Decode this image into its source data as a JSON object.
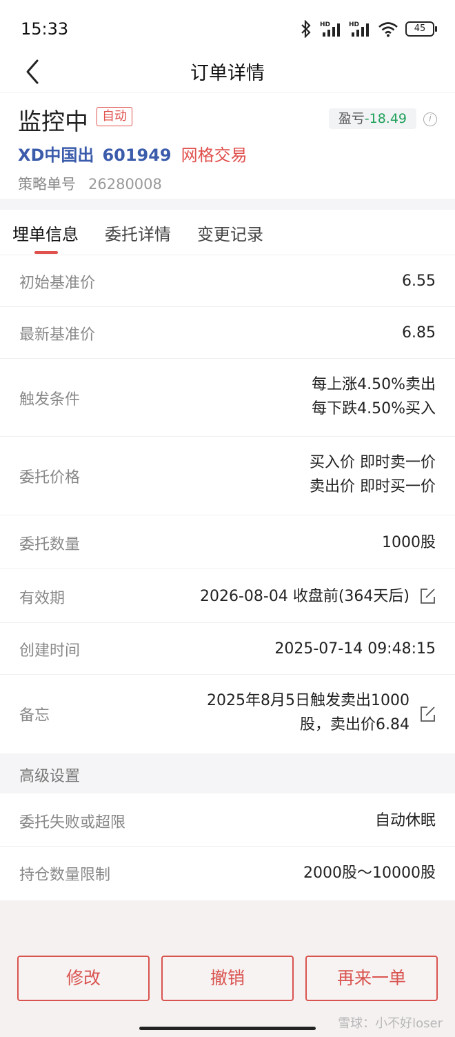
{
  "status_bar": {
    "time": "15:33",
    "battery": "45",
    "hd1": "HD",
    "hd2": "HD"
  },
  "nav": {
    "title": "订单详情"
  },
  "summary": {
    "status": "监控中",
    "mode_tag": "自动",
    "pnl_label": "盈亏",
    "pnl_value": "-18.49",
    "stock_name": "XD中国出",
    "stock_code": "601949",
    "strategy_type": "网格交易",
    "order_no_label": "策略单号",
    "order_no": "26280008"
  },
  "tabs": [
    {
      "label": "埋单信息",
      "active": true
    },
    {
      "label": "委托详情",
      "active": false
    },
    {
      "label": "变更记录",
      "active": false
    }
  ],
  "rows": [
    {
      "label": "初始基准价",
      "value": [
        "6.55"
      ]
    },
    {
      "label": "最新基准价",
      "value": [
        "6.85"
      ]
    },
    {
      "label": "触发条件",
      "value": [
        "每上涨4.50%卖出",
        "每下跌4.50%买入"
      ]
    },
    {
      "label": "委托价格",
      "value": [
        "买入价 即时卖一价",
        "卖出价 即时买一价"
      ]
    },
    {
      "label": "委托数量",
      "value": [
        "1000股"
      ]
    },
    {
      "label": "有效期",
      "value": [
        "2026-08-04 收盘前(364天后)"
      ],
      "editable": true
    },
    {
      "label": "创建时间",
      "value": [
        "2025-07-14 09:48:15"
      ]
    },
    {
      "label": "备忘",
      "value": [
        "2025年8月5日触发卖出1000",
        "股，卖出价6.84"
      ],
      "editable": true
    }
  ],
  "advanced": {
    "title": "高级设置",
    "rows": [
      {
        "label": "委托失败或超限",
        "value": "自动休眠"
      },
      {
        "label": "持仓数量限制",
        "value": "2000股～10000股"
      }
    ]
  },
  "buttons": {
    "modify": "修改",
    "cancel": "撤销",
    "again": "再来一单"
  },
  "watermark": "雪球：小不好loser",
  "colors": {
    "accent_red": "#e0514d",
    "stock_blue": "#3b5bab",
    "loss_green": "#1fa15a"
  }
}
